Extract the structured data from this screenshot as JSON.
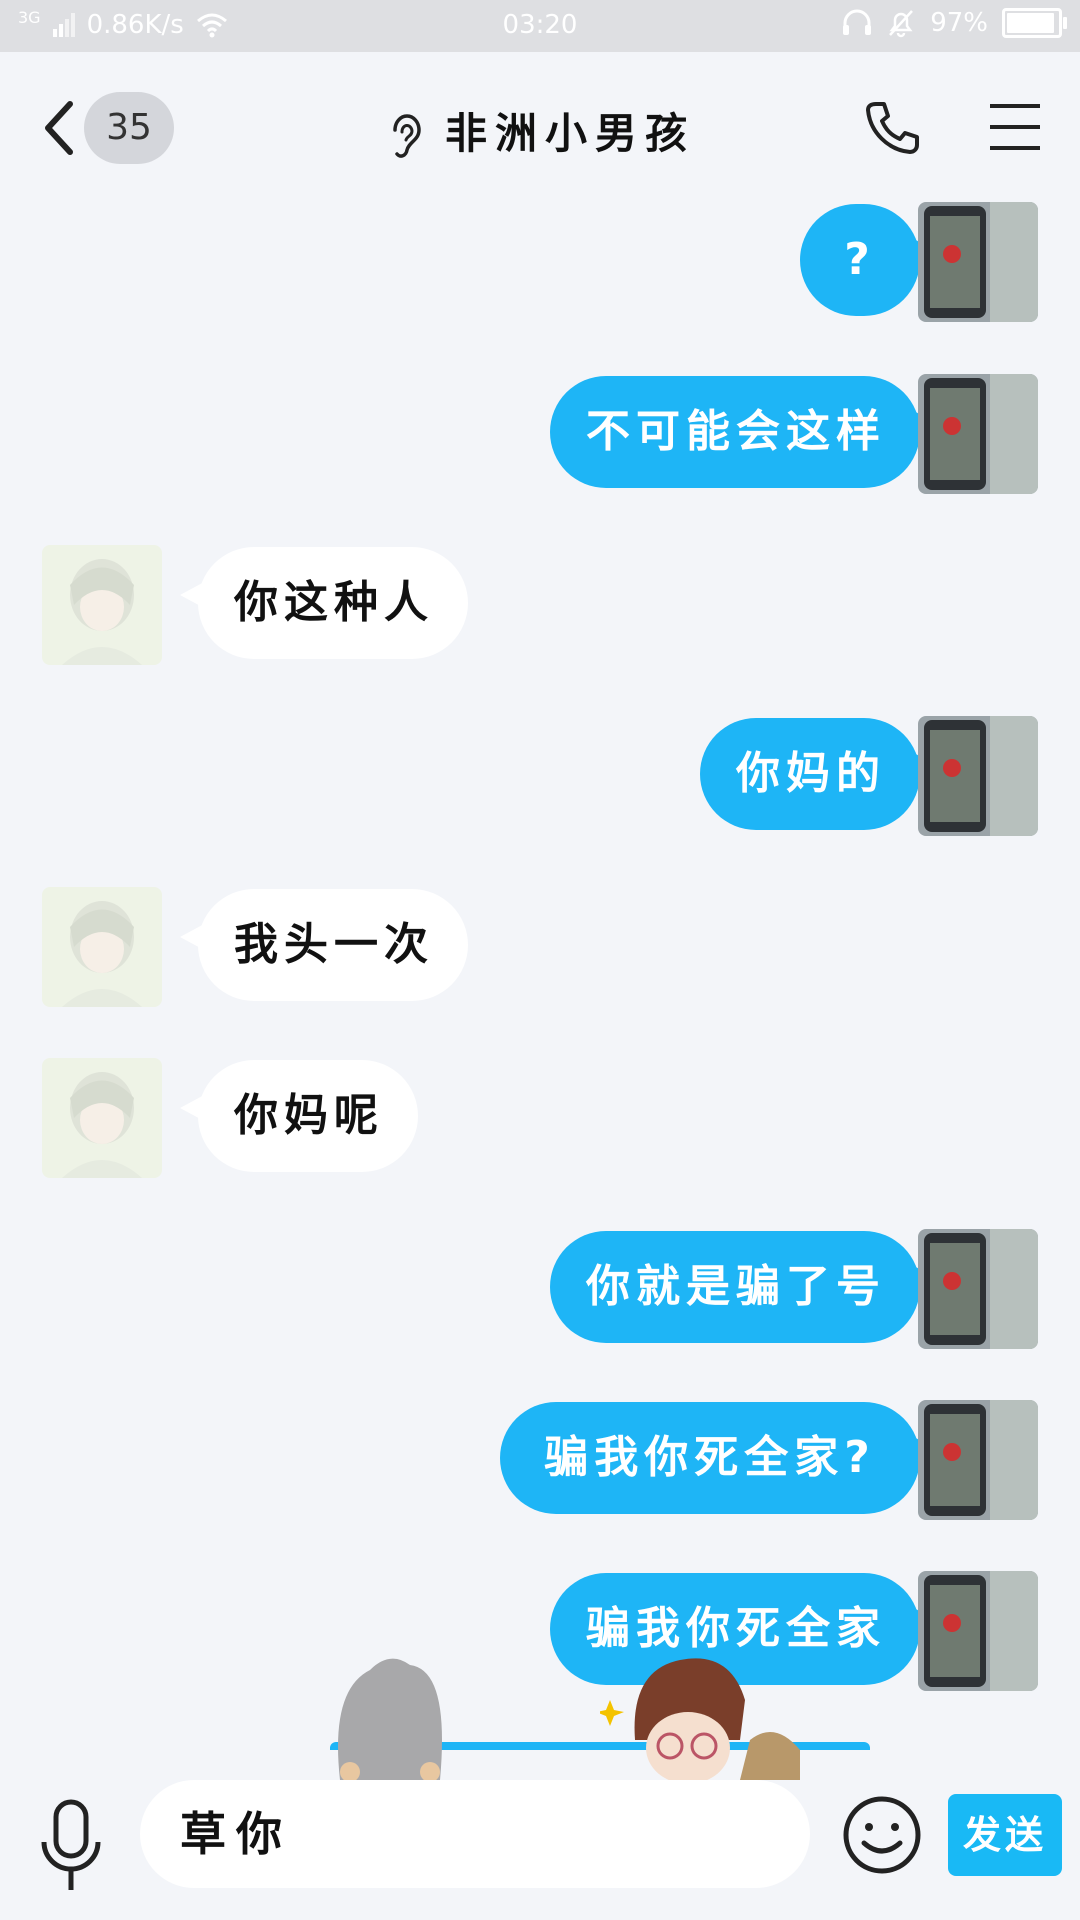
{
  "status_bar": {
    "network": "3G",
    "speed": "0.86K/s",
    "time": "03:20",
    "battery": "97%",
    "battery_level": 0.97
  },
  "header": {
    "unread_count": "35",
    "title": "非洲小男孩"
  },
  "messages": [
    {
      "side": "out",
      "text": "?"
    },
    {
      "side": "out",
      "text": "不可能会这样"
    },
    {
      "side": "in",
      "text": "你这种人"
    },
    {
      "side": "out",
      "text": "你妈的"
    },
    {
      "side": "in",
      "text": "我头一次"
    },
    {
      "side": "in",
      "text": "你妈呢"
    },
    {
      "side": "out",
      "text": "你就是骗了号"
    },
    {
      "side": "out",
      "text": "骗我你死全家?"
    },
    {
      "side": "out",
      "text": "骗我你死全家"
    }
  ],
  "input": {
    "value": "草你",
    "send_label": "发送"
  },
  "colors": {
    "outgoing_bubble": "#1eb5f6",
    "incoming_bubble": "#ffffff",
    "send_button": "#19b9f5"
  },
  "icons": [
    "back-icon",
    "ear-icon",
    "phone-icon",
    "menu-icon",
    "mic-icon",
    "emoji-icon",
    "signal-icon",
    "wifi-icon",
    "headset-icon",
    "bell-off-icon"
  ]
}
